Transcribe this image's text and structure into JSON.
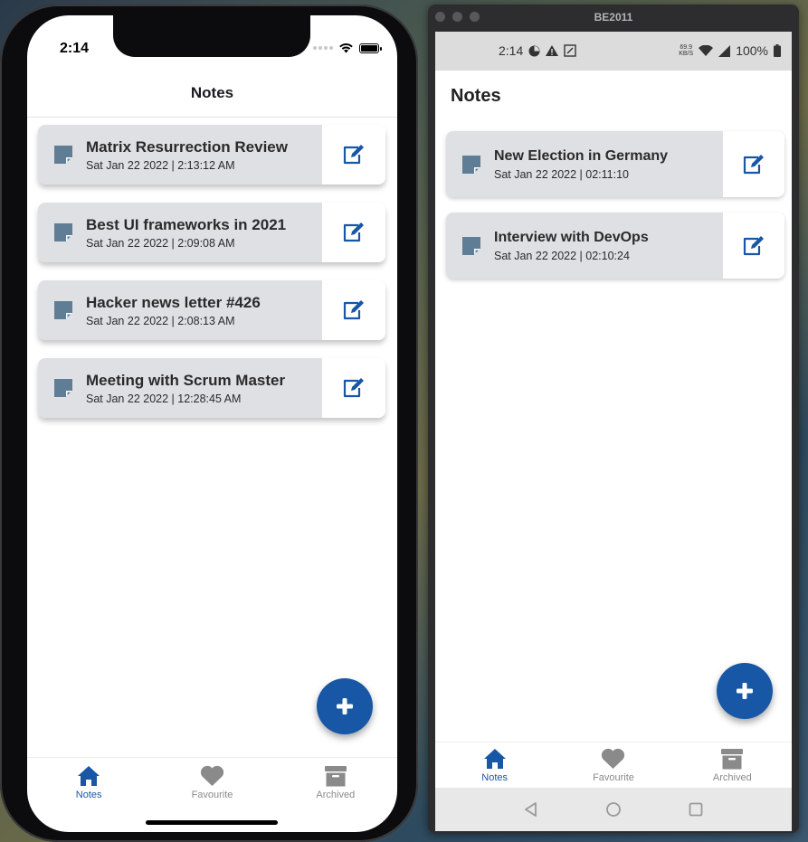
{
  "ios": {
    "time": "2:14",
    "header_title": "Notes",
    "notes": [
      {
        "title": "Matrix Resurrection Review",
        "date": "Sat Jan 22 2022 | 2:13:12 AM"
      },
      {
        "title": "Best UI frameworks in 2021",
        "date": "Sat Jan 22 2022 | 2:09:08 AM"
      },
      {
        "title": "Hacker news letter #426",
        "date": "Sat Jan 22 2022 | 2:08:13 AM"
      },
      {
        "title": "Meeting with Scrum Master",
        "date": "Sat Jan 22 2022 | 12:28:45 AM"
      }
    ],
    "tabs": [
      {
        "label": "Notes",
        "icon": "home-icon",
        "active": true
      },
      {
        "label": "Favourite",
        "icon": "heart-icon",
        "active": false
      },
      {
        "label": "Archived",
        "icon": "archive-icon",
        "active": false
      }
    ]
  },
  "android": {
    "window_title": "BE2011",
    "time": "2:14",
    "net_speed": "69.9 KB/S",
    "battery": "100%",
    "header_title": "Notes",
    "notes": [
      {
        "title": "New Election in Germany",
        "date": "Sat Jan 22 2022 | 02:11:10"
      },
      {
        "title": "Interview with DevOps",
        "date": "Sat Jan 22 2022 | 02:10:24"
      }
    ],
    "tabs": [
      {
        "label": "Notes",
        "icon": "home-icon",
        "active": true
      },
      {
        "label": "Favourite",
        "icon": "heart-icon",
        "active": false
      },
      {
        "label": "Archived",
        "icon": "archive-icon",
        "active": false
      }
    ]
  },
  "colors": {
    "accent": "#1757a6",
    "card_bg": "#dee0e3",
    "note_icon": "#5f7d95",
    "inactive": "#8a8a8a"
  }
}
